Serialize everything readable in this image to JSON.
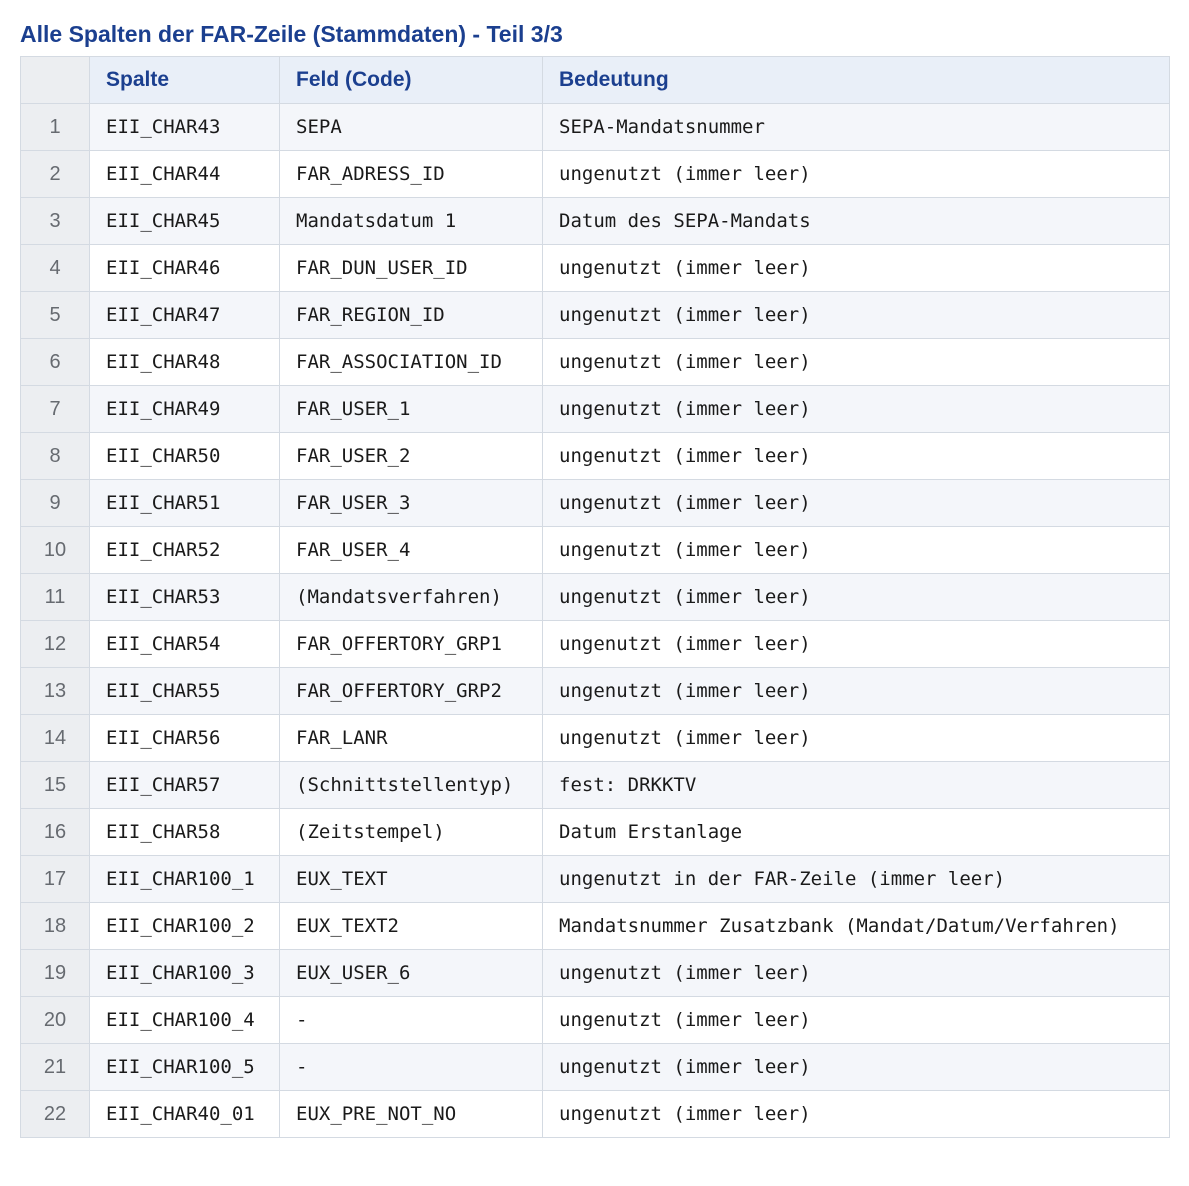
{
  "title": "Alle Spalten der FAR-Zeile (Stammdaten) - Teil 3/3",
  "table": {
    "headers": [
      "",
      "Spalte",
      "Feld (Code)",
      "Bedeutung"
    ],
    "rows": [
      {
        "num": "1",
        "spalte": "EII_CHAR43",
        "feld": "SEPA",
        "bedeutung": "SEPA-Mandatsnummer"
      },
      {
        "num": "2",
        "spalte": "EII_CHAR44",
        "feld": "FAR_ADRESS_ID",
        "bedeutung": "ungenutzt (immer leer)"
      },
      {
        "num": "3",
        "spalte": "EII_CHAR45",
        "feld": "Mandatsdatum 1",
        "bedeutung": "Datum des SEPA-Mandats"
      },
      {
        "num": "4",
        "spalte": "EII_CHAR46",
        "feld": "FAR_DUN_USER_ID",
        "bedeutung": "ungenutzt (immer leer)"
      },
      {
        "num": "5",
        "spalte": "EII_CHAR47",
        "feld": "FAR_REGION_ID",
        "bedeutung": "ungenutzt (immer leer)"
      },
      {
        "num": "6",
        "spalte": "EII_CHAR48",
        "feld": "FAR_ASSOCIATION_ID",
        "bedeutung": "ungenutzt (immer leer)"
      },
      {
        "num": "7",
        "spalte": "EII_CHAR49",
        "feld": "FAR_USER_1",
        "bedeutung": "ungenutzt (immer leer)"
      },
      {
        "num": "8",
        "spalte": "EII_CHAR50",
        "feld": "FAR_USER_2",
        "bedeutung": "ungenutzt (immer leer)"
      },
      {
        "num": "9",
        "spalte": "EII_CHAR51",
        "feld": "FAR_USER_3",
        "bedeutung": "ungenutzt (immer leer)"
      },
      {
        "num": "10",
        "spalte": "EII_CHAR52",
        "feld": "FAR_USER_4",
        "bedeutung": "ungenutzt (immer leer)"
      },
      {
        "num": "11",
        "spalte": "EII_CHAR53",
        "feld": "(Mandatsverfahren)",
        "bedeutung": "ungenutzt (immer leer)"
      },
      {
        "num": "12",
        "spalte": "EII_CHAR54",
        "feld": "FAR_OFFERTORY_GRP1",
        "bedeutung": "ungenutzt (immer leer)"
      },
      {
        "num": "13",
        "spalte": "EII_CHAR55",
        "feld": "FAR_OFFERTORY_GRP2",
        "bedeutung": "ungenutzt (immer leer)"
      },
      {
        "num": "14",
        "spalte": "EII_CHAR56",
        "feld": "FAR_LANR",
        "bedeutung": "ungenutzt (immer leer)"
      },
      {
        "num": "15",
        "spalte": "EII_CHAR57",
        "feld": "(Schnittstellentyp)",
        "bedeutung": "fest: DRKKTV"
      },
      {
        "num": "16",
        "spalte": "EII_CHAR58",
        "feld": "(Zeitstempel)",
        "bedeutung": "Datum Erstanlage"
      },
      {
        "num": "17",
        "spalte": "EII_CHAR100_1",
        "feld": "EUX_TEXT",
        "bedeutung": "ungenutzt in der FAR-Zeile (immer leer)"
      },
      {
        "num": "18",
        "spalte": "EII_CHAR100_2",
        "feld": "EUX_TEXT2",
        "bedeutung": "Mandatsnummer Zusatzbank (Mandat/Datum/Verfahren)"
      },
      {
        "num": "19",
        "spalte": "EII_CHAR100_3",
        "feld": "EUX_USER_6",
        "bedeutung": "ungenutzt (immer leer)"
      },
      {
        "num": "20",
        "spalte": "EII_CHAR100_4",
        "feld": "-",
        "bedeutung": "ungenutzt (immer leer)"
      },
      {
        "num": "21",
        "spalte": "EII_CHAR100_5",
        "feld": "-",
        "bedeutung": "ungenutzt (immer leer)"
      },
      {
        "num": "22",
        "spalte": "EII_CHAR40_01",
        "feld": "EUX_PRE_NOT_NO",
        "bedeutung": "ungenutzt (immer leer)"
      }
    ]
  },
  "colors": {
    "heading": "#1b3f8f",
    "header_bg": "#e9eff8",
    "row_alt_bg": "#f4f6fa",
    "number_col_bg": "#eceef1",
    "border": "#d4dae2"
  }
}
